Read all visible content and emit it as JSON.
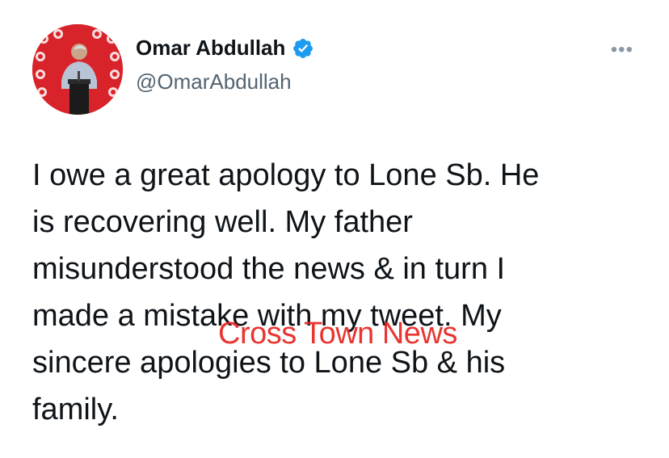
{
  "author": {
    "display_name": "Omar Abdullah",
    "handle": "@OmarAbdullah",
    "verified_icon": "verified-badge-icon",
    "avatar_icon": "profile-photo"
  },
  "tweet": {
    "text": "I owe a great apology to Lone Sb. He\nis recovering well. My father\nmisunderstood the news & in turn I\nmade a mistake with my tweet. My\nsincere apologies to Lone Sb & his\nfamily."
  },
  "more_menu": {
    "label": "•••",
    "icon": "more-options-icon"
  },
  "watermark": {
    "text": "Cross Town News"
  },
  "colors": {
    "text_primary": "#0f1419",
    "text_secondary": "#536471",
    "verified_blue": "#1d9bf0",
    "avatar_red": "#d8232a",
    "watermark_red": "#e8231f"
  }
}
